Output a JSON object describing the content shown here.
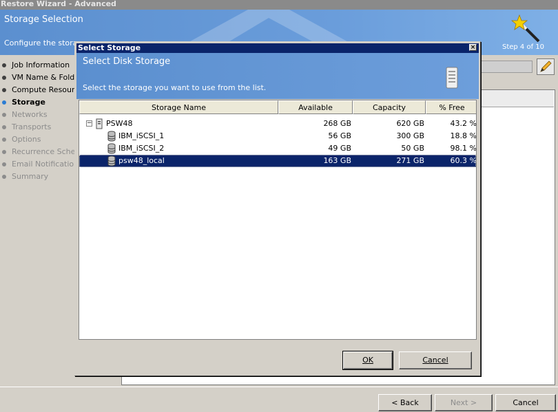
{
  "window": {
    "title": "Restore Wizard - Advanced"
  },
  "banner": {
    "title": "Storage Selection",
    "subtitle": "Configure the storag",
    "step": "Step 4 of 10"
  },
  "nav": {
    "items": [
      {
        "label": "Job Information",
        "state": "done"
      },
      {
        "label": "VM Name & Folder",
        "state": "done"
      },
      {
        "label": "Compute Resource",
        "state": "done"
      },
      {
        "label": "Storage",
        "state": "active"
      },
      {
        "label": "Networks",
        "state": "disabled"
      },
      {
        "label": "Transports",
        "state": "disabled"
      },
      {
        "label": "Options",
        "state": "disabled"
      },
      {
        "label": "Recurrence Schedule",
        "state": "disabled"
      },
      {
        "label": "Email Notification",
        "state": "disabled"
      },
      {
        "label": "Summary",
        "state": "disabled"
      }
    ]
  },
  "wizard_buttons": {
    "back": "< Back",
    "next": "Next >",
    "cancel": "Cancel"
  },
  "dialog": {
    "title": "Select Storage",
    "close": "×",
    "header_title": "Select Disk Storage",
    "header_subtitle": "Select the storage you want to use from the list.",
    "columns": [
      "Storage Name",
      "Available",
      "Capacity",
      "% Free"
    ],
    "rows": [
      {
        "level": 0,
        "icon": "server-icon",
        "expander": "−",
        "name": "PSW48",
        "available": "268 GB",
        "capacity": "620 GB",
        "free": "43.2 %",
        "selected": false
      },
      {
        "level": 1,
        "icon": "database-icon",
        "name": "IBM_iSCSI_1",
        "available": "56 GB",
        "capacity": "300 GB",
        "free": "18.8 %",
        "selected": false
      },
      {
        "level": 1,
        "icon": "database-icon",
        "name": "IBM_iSCSI_2",
        "available": "49 GB",
        "capacity": "50 GB",
        "free": "98.1 %",
        "selected": false
      },
      {
        "level": 1,
        "icon": "database-icon",
        "name": "psw48_local",
        "available": "163 GB",
        "capacity": "271 GB",
        "free": "60.3 %",
        "selected": true
      }
    ],
    "ok": "OK",
    "cancel": "Cancel"
  }
}
